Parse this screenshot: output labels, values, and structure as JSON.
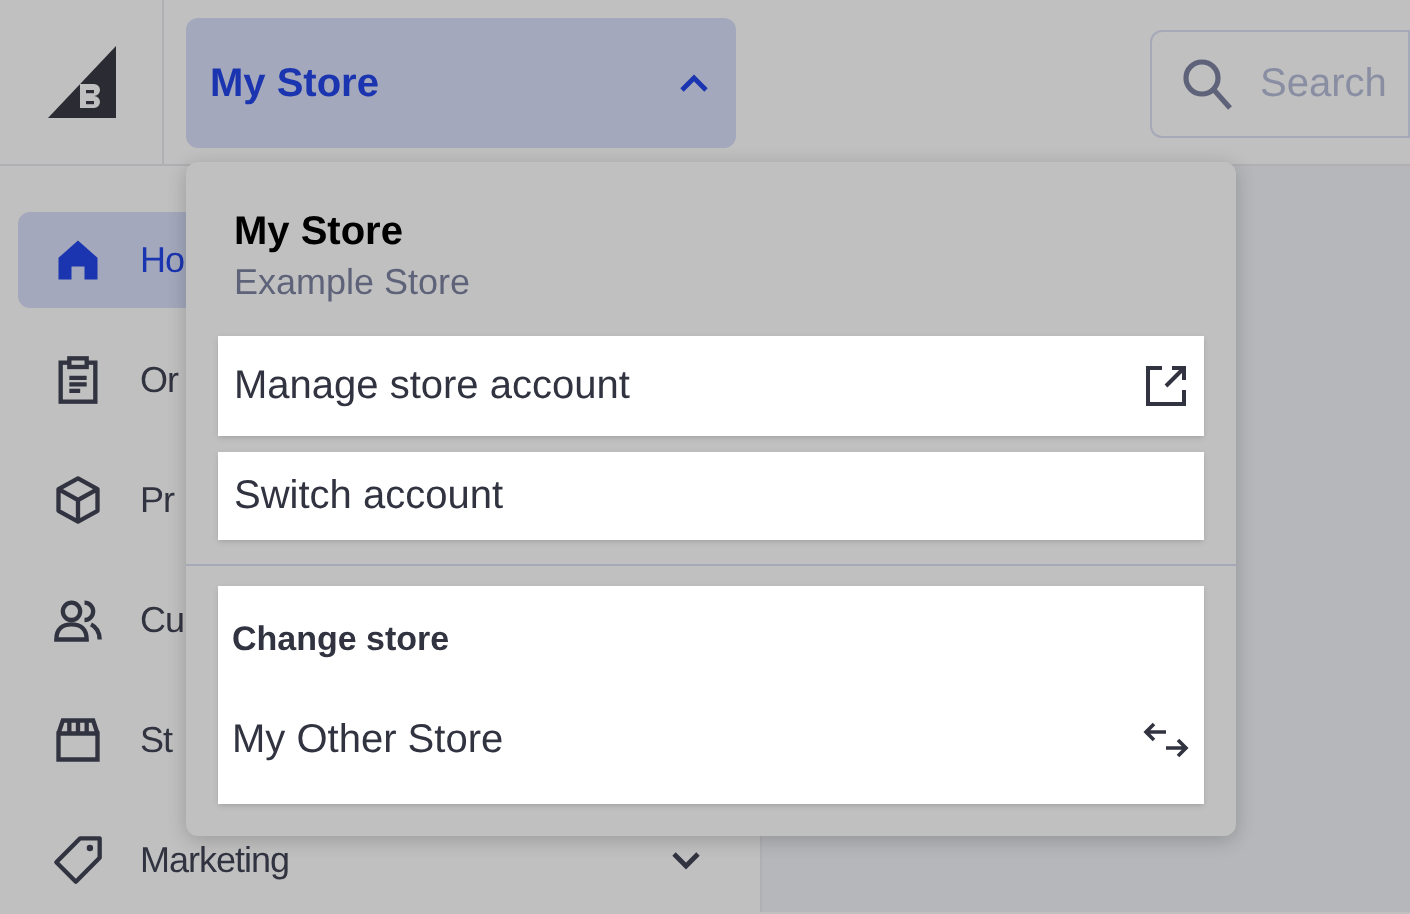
{
  "store_switcher": {
    "label": "My Store",
    "expanded": true
  },
  "search": {
    "placeholder": "Search"
  },
  "sidebar": {
    "items": [
      {
        "kind": "home",
        "label": "Ho",
        "selected": true,
        "expandable": false
      },
      {
        "kind": "orders",
        "label": "Or",
        "selected": false,
        "expandable": false
      },
      {
        "kind": "products",
        "label": "Pr",
        "selected": false,
        "expandable": false
      },
      {
        "kind": "customers",
        "label": "Cu",
        "selected": false,
        "expandable": false
      },
      {
        "kind": "storefront",
        "label": "St",
        "selected": false,
        "expandable": false
      },
      {
        "kind": "marketing",
        "label": "Marketing",
        "selected": false,
        "expandable": true
      }
    ]
  },
  "menu": {
    "title": "My Store",
    "subtitle": "Example Store",
    "actions": [
      {
        "label": "Manage store account",
        "external": true
      },
      {
        "label": "Switch account",
        "external": false
      }
    ],
    "change_store": {
      "heading": "Change store",
      "stores": [
        {
          "label": "My Other Store"
        }
      ]
    }
  }
}
